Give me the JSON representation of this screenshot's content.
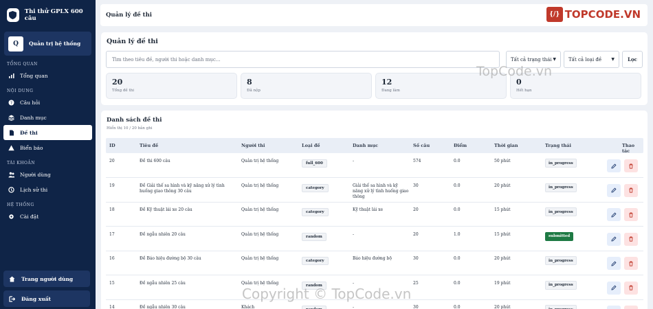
{
  "app": {
    "title": "Thi thử GPLX 600 câu"
  },
  "user": {
    "initial": "Q",
    "name": "Quản trị hệ thống"
  },
  "sidebar": {
    "sections": {
      "overview": "TỔNG QUAN",
      "content": "NỘI DUNG",
      "account": "TÀI KHOẢN",
      "system": "HỆ THỐNG"
    },
    "items": {
      "dashboard": "Tổng quan",
      "questions": "Câu hỏi",
      "categories": "Danh mục",
      "exams": "Đề thi",
      "signs": "Biển báo",
      "users": "Người dùng",
      "history": "Lịch sử thi",
      "settings": "Cài đặt"
    },
    "user_page": "Trang người dùng",
    "logout": "Đăng xuất"
  },
  "header": {
    "title": "Quản lý đề thi"
  },
  "brand_logo": {
    "mark": "{/}",
    "text": "TOPCODE.VN"
  },
  "filters": {
    "title": "Quản lý đề thi",
    "search_placeholder": "Tìm theo tiêu đề, người thi hoặc danh mục...",
    "status_select": "Tất cả trạng thái",
    "type_select": "Tất cả loại đề",
    "filter_button": "Lọc"
  },
  "stats": [
    {
      "value": "20",
      "label": "Tổng đề thi"
    },
    {
      "value": "8",
      "label": "Đã nộp"
    },
    {
      "value": "12",
      "label": "Đang làm"
    },
    {
      "value": "0",
      "label": "Hết hạn"
    }
  ],
  "list": {
    "title": "Danh sách đề thi",
    "subtitle": "Hiển thị 10 / 20 bản ghi",
    "columns": {
      "id": "ID",
      "title": "Tiêu đề",
      "user": "Người thi",
      "type": "Loại đề",
      "category": "Danh mục",
      "count": "Số câu",
      "score": "Điểm",
      "time": "Thời gian",
      "status": "Trạng thái",
      "actions": "Thao tác"
    },
    "rows": [
      {
        "id": "20",
        "title": "Đề thi 600 câu",
        "user": "Quản trị hệ thống",
        "type": "full_600",
        "category": "-",
        "count": "574",
        "score": "0.0",
        "time": "50 phút",
        "status": "in_progress"
      },
      {
        "id": "19",
        "title": "Đề Giải thế sa hình và kỹ năng xử lý tình huống giao thông 30 câu",
        "user": "Quản trị hệ thống",
        "type": "category",
        "category": "Giải thế sa hình và kỹ năng xử lý tình huống giao thông",
        "count": "30",
        "score": "0.0",
        "time": "20 phút",
        "status": "in_progress"
      },
      {
        "id": "18",
        "title": "Đề Kỹ thuật lái xe 20 câu",
        "user": "Quản trị hệ thống",
        "type": "category",
        "category": "Kỹ thuật lái xe",
        "count": "20",
        "score": "0.0",
        "time": "15 phút",
        "status": "in_progress"
      },
      {
        "id": "17",
        "title": "Đề ngẫu nhiên 20 câu",
        "user": "Quản trị hệ thống",
        "type": "random",
        "category": "-",
        "count": "20",
        "score": "1.0",
        "time": "15 phút",
        "status": "submitted"
      },
      {
        "id": "16",
        "title": "Đề Báo hiệu đường bộ 30 câu",
        "user": "Quản trị hệ thống",
        "type": "category",
        "category": "Báo hiệu đường bộ",
        "count": "30",
        "score": "0.0",
        "time": "20 phút",
        "status": "in_progress"
      },
      {
        "id": "15",
        "title": "Đề ngẫu nhiên 25 câu",
        "user": "Quản trị hệ thống",
        "type": "random",
        "category": "-",
        "count": "25",
        "score": "0.0",
        "time": "19 phút",
        "status": "in_progress"
      },
      {
        "id": "14",
        "title": "Đề ngẫu nhiên 30 câu",
        "user": "Khách",
        "type": "random",
        "category": "-",
        "count": "30",
        "score": "0.0",
        "time": "20 phút",
        "status": "in_progress"
      }
    ]
  },
  "watermarks": {
    "mid": "TopCode.vn",
    "bottom": "Copyright © TopCode.vn"
  },
  "colors": {
    "sidebar_bg": "#0f2447",
    "accent": "#1e3a6e",
    "submitted": "#1e7a44",
    "danger": "#c0392b"
  }
}
